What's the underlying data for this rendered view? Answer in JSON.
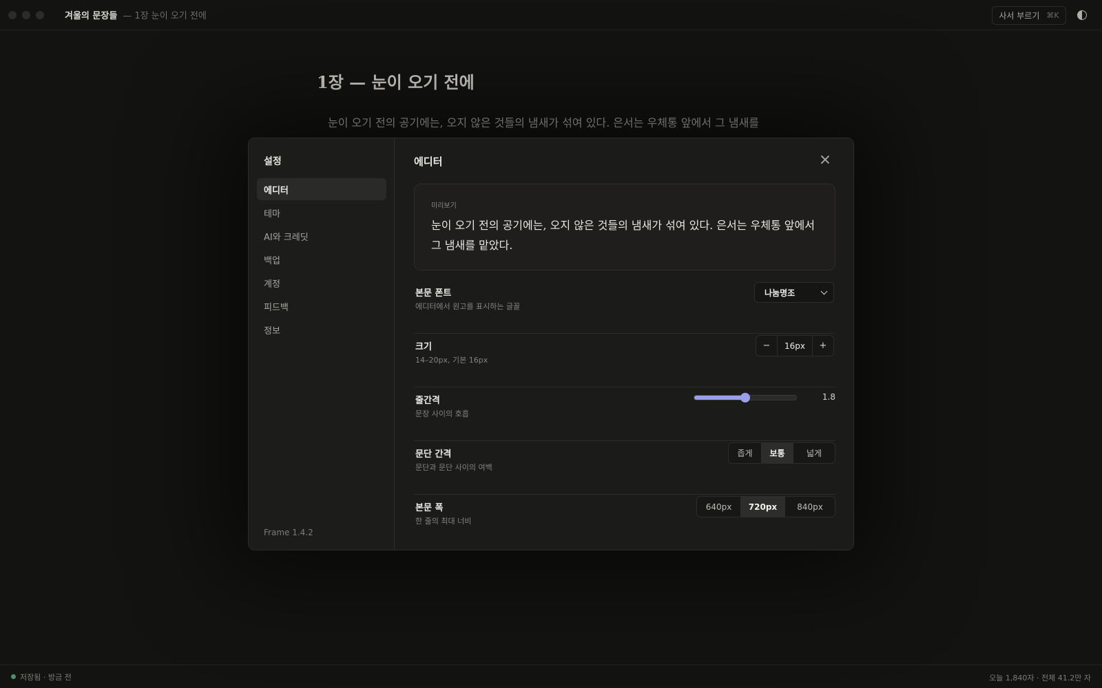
{
  "titlebar": {
    "doc_title": "겨울의 문장들",
    "doc_subtitle": "— 1장 눈이 오기 전에",
    "dict_button_label": "사서 부르기",
    "dict_shortcut": "⌘K"
  },
  "document": {
    "heading": "1장 — 눈이 오기 전에",
    "paragraph": "눈이 오기 전의 공기에는, 오지 않은 것들의 냄새가 섞여 있다. 은서는 우체통 앞에서 그 냄새를"
  },
  "settings": {
    "title": "설정",
    "nav": [
      {
        "label": "에디터",
        "active": true
      },
      {
        "label": "테마",
        "active": false
      },
      {
        "label": "AI와 크레딧",
        "active": false
      },
      {
        "label": "백업",
        "active": false
      },
      {
        "label": "계정",
        "active": false
      },
      {
        "label": "피드백",
        "active": false
      },
      {
        "label": "정보",
        "active": false
      }
    ],
    "version": "Frame 1.4.2",
    "section_title": "에디터",
    "preview": {
      "label": "미리보기",
      "text": "눈이 오기 전의 공기에는, 오지 않은 것들의 냄새가 섞여 있다. 은서는 우체통 앞에서 그 냄새를 맡았다."
    },
    "font": {
      "label": "본문 폰트",
      "description": "에디터에서 원고를 표시하는 글꼴",
      "selected": "나눔명조"
    },
    "size": {
      "label": "크기",
      "description": "14–20px, 기본 16px",
      "value": "16px",
      "decrement": "−",
      "increment": "+"
    },
    "line_height": {
      "label": "줄간격",
      "description": "문장 사이의 호흡",
      "value": "1.8",
      "slider_fraction": 0.5
    },
    "paragraph_spacing": {
      "label": "문단 간격",
      "description": "문단과 문단 사이의 여백",
      "options": [
        "좁게",
        "보통",
        "넓게"
      ],
      "selected_index": 1
    },
    "content_width": {
      "label": "본문 폭",
      "description": "한 줄의 최대 너비",
      "options": [
        "640px",
        "720px",
        "840px"
      ],
      "selected_index": 1
    }
  },
  "statusbar": {
    "left": "저장됨 · 방금 전",
    "right": "오늘 1,840자 · 전체 41.2만 자"
  },
  "colors": {
    "accent": "#9aa0e6",
    "saved_status": "#4f8f6a",
    "background": "#131312"
  }
}
